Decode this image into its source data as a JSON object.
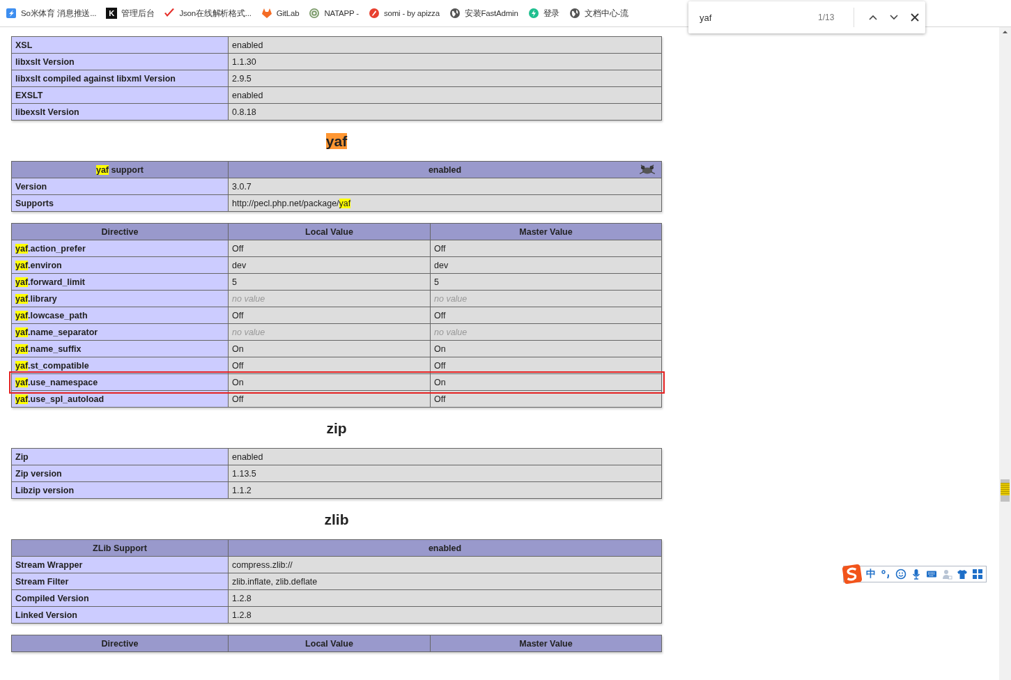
{
  "bookmarks": [
    {
      "label": "So米体育 消息推送..."
    },
    {
      "label": "管理后台",
      "icon_text": "K"
    },
    {
      "label": "Json在线解析格式..."
    },
    {
      "label": "GitLab"
    },
    {
      "label": "NATAPP -"
    },
    {
      "label": "somi - by apizza"
    },
    {
      "label": "安装FastAdmin"
    },
    {
      "label": "登录"
    },
    {
      "label": "文档中心-流"
    }
  ],
  "find_bar": {
    "query": "yaf",
    "count": "1/13"
  },
  "sections": [
    {
      "tables": [
        {
          "rows": [
            {
              "cells": [
                "XSL",
                "enabled"
              ],
              "outlined": false
            },
            {
              "cells": [
                "libxslt Version",
                "1.1.30"
              ],
              "outlined": false
            },
            {
              "cells": [
                "libxslt compiled against libxml Version",
                "2.9.5"
              ],
              "outlined": false
            },
            {
              "cells": [
                "EXSLT",
                "enabled"
              ],
              "outlined": false
            },
            {
              "cells": [
                "libexslt Version",
                "0.8.18"
              ],
              "outlined": false
            }
          ]
        }
      ]
    },
    {
      "title": [
        {
          "text": "yaf",
          "match": true,
          "current": true
        }
      ],
      "tables": [
        {
          "header": [
            {
              "parts": [
                {
                  "text": "yaf",
                  "match": true,
                  "current": false
                },
                {
                  "text": " support",
                  "match": false,
                  "current": false
                }
              ]
            },
            "enabled"
          ],
          "logo": true,
          "rows": [
            {
              "cells": [
                "Version",
                "3.0.7"
              ],
              "outlined": false
            },
            {
              "cells": [
                "Supports",
                {
                  "parts": [
                    {
                      "text": "http://pecl.php.net/package/",
                      "match": false,
                      "current": false
                    },
                    {
                      "text": "yaf",
                      "match": true,
                      "current": false
                    }
                  ]
                }
              ],
              "outlined": false
            }
          ]
        },
        {
          "header": [
            "Directive",
            "Local Value",
            "Master Value"
          ],
          "rows": [
            {
              "cells": [
                {
                  "parts": [
                    {
                      "text": "yaf",
                      "match": true,
                      "current": false
                    },
                    {
                      "text": ".action_prefer",
                      "match": false,
                      "current": false
                    }
                  ]
                },
                "Off",
                "Off"
              ],
              "outlined": false
            },
            {
              "cells": [
                {
                  "parts": [
                    {
                      "text": "yaf",
                      "match": true,
                      "current": false
                    },
                    {
                      "text": ".environ",
                      "match": false,
                      "current": false
                    }
                  ]
                },
                "dev",
                "dev"
              ],
              "outlined": false
            },
            {
              "cells": [
                {
                  "parts": [
                    {
                      "text": "yaf",
                      "match": true,
                      "current": false
                    },
                    {
                      "text": ".forward_limit",
                      "match": false,
                      "current": false
                    }
                  ]
                },
                "5",
                "5"
              ],
              "outlined": false
            },
            {
              "cells": [
                {
                  "parts": [
                    {
                      "text": "yaf",
                      "match": true,
                      "current": false
                    },
                    {
                      "text": ".library",
                      "match": false,
                      "current": false
                    }
                  ]
                },
                {
                  "text": "no value",
                  "kind": "empty"
                },
                {
                  "text": "no value",
                  "kind": "empty"
                }
              ],
              "outlined": false
            },
            {
              "cells": [
                {
                  "parts": [
                    {
                      "text": "yaf",
                      "match": true,
                      "current": false
                    },
                    {
                      "text": ".lowcase_path",
                      "match": false,
                      "current": false
                    }
                  ]
                },
                "Off",
                "Off"
              ],
              "outlined": false
            },
            {
              "cells": [
                {
                  "parts": [
                    {
                      "text": "yaf",
                      "match": true,
                      "current": false
                    },
                    {
                      "text": ".name_separator",
                      "match": false,
                      "current": false
                    }
                  ]
                },
                {
                  "text": "no value",
                  "kind": "empty"
                },
                {
                  "text": "no value",
                  "kind": "empty"
                }
              ],
              "outlined": false
            },
            {
              "cells": [
                {
                  "parts": [
                    {
                      "text": "yaf",
                      "match": true,
                      "current": false
                    },
                    {
                      "text": ".name_suffix",
                      "match": false,
                      "current": false
                    }
                  ]
                },
                "On",
                "On"
              ],
              "outlined": false
            },
            {
              "cells": [
                {
                  "parts": [
                    {
                      "text": "yaf",
                      "match": true,
                      "current": false
                    },
                    {
                      "text": ".st_compatible",
                      "match": false,
                      "current": false
                    }
                  ]
                },
                "Off",
                "Off"
              ],
              "outlined": false
            },
            {
              "cells": [
                {
                  "parts": [
                    {
                      "text": "yaf",
                      "match": true,
                      "current": false
                    },
                    {
                      "text": ".use_namespace",
                      "match": false,
                      "current": false
                    }
                  ]
                },
                "On",
                "On"
              ],
              "outlined": true
            },
            {
              "cells": [
                {
                  "parts": [
                    {
                      "text": "yaf",
                      "match": true,
                      "current": false
                    },
                    {
                      "text": ".use_spl_autoload",
                      "match": false,
                      "current": false
                    }
                  ]
                },
                "Off",
                "Off"
              ],
              "outlined": false
            }
          ]
        }
      ]
    },
    {
      "title": [
        {
          "text": "zip",
          "match": false,
          "current": false
        }
      ],
      "tables": [
        {
          "rows": [
            {
              "cells": [
                "Zip",
                "enabled"
              ],
              "outlined": false
            },
            {
              "cells": [
                "Zip version",
                "1.13.5"
              ],
              "outlined": false
            },
            {
              "cells": [
                "Libzip version",
                "1.1.2"
              ],
              "outlined": false
            }
          ]
        }
      ]
    },
    {
      "title": [
        {
          "text": "zlib",
          "match": false,
          "current": false
        }
      ],
      "tables": [
        {
          "header": [
            "ZLib Support",
            "enabled"
          ],
          "rows": [
            {
              "cells": [
                "Stream Wrapper",
                "compress.zlib://"
              ],
              "outlined": false
            },
            {
              "cells": [
                "Stream Filter",
                "zlib.inflate, zlib.deflate"
              ],
              "outlined": false
            },
            {
              "cells": [
                "Compiled Version",
                "1.2.8"
              ],
              "outlined": false
            },
            {
              "cells": [
                "Linked Version",
                "1.2.8"
              ],
              "outlined": false
            }
          ]
        },
        {
          "header": [
            "Directive",
            "Local Value",
            "Master Value"
          ]
        }
      ]
    }
  ],
  "ime": {
    "mode": "中"
  }
}
